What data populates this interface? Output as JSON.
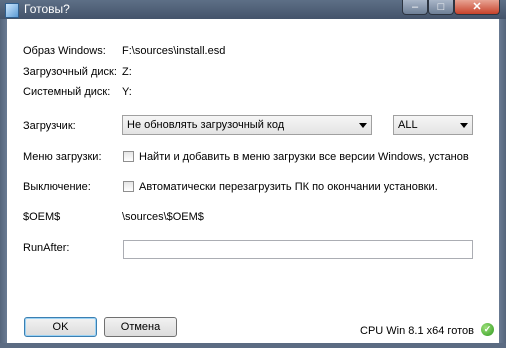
{
  "window": {
    "title": "Готовы?",
    "minimize": "–",
    "maximize": "□",
    "close": "✕"
  },
  "form": {
    "image": {
      "label": "Образ Windows:",
      "value": "F:\\sources\\install.esd"
    },
    "boot_disk": {
      "label": "Загрузочный диск:",
      "value": "Z:"
    },
    "system_disk": {
      "label": "Системный диск:",
      "value": "Y:"
    },
    "bootloader": {
      "label": "Загрузчик:",
      "selected": "Не обновлять загрузочный код",
      "target_selected": "ALL"
    },
    "boot_menu": {
      "label": "Меню загрузки:",
      "checkbox_label": "Найти и добавить в меню загрузки все версии Windows, установ",
      "checked": false
    },
    "shutdown": {
      "label": "Выключение:",
      "checkbox_label": "Автоматически перезагрузить ПК по окончании установки.",
      "checked": false
    },
    "oem": {
      "label": "$OEM$",
      "value": "\\sources\\$OEM$"
    },
    "runafter": {
      "label": "RunAfter:",
      "value": ""
    }
  },
  "footer": {
    "ok": "OK",
    "cancel": "Отмена",
    "status": "CPU Win 8.1 x64 готов",
    "status_icon": "check-circle-icon",
    "status_color": "#2f9a20"
  }
}
